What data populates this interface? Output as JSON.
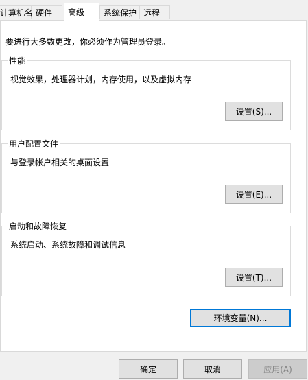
{
  "tabs": [
    {
      "label": "计算机名",
      "active": false
    },
    {
      "label": "硬件",
      "active": false
    },
    {
      "label": "高级",
      "active": true
    },
    {
      "label": "系统保护",
      "active": false
    },
    {
      "label": "远程",
      "active": false
    }
  ],
  "intro": "要进行大多数更改，你必须作为管理员登录。",
  "performance": {
    "title": "性能",
    "description": "视觉效果，处理器计划，内存使用，以及虚拟内存",
    "button": "设置(S)..."
  },
  "user_profiles": {
    "title": "用户配置文件",
    "description": "与登录帐户相关的桌面设置",
    "button": "设置(E)..."
  },
  "startup_recovery": {
    "title": "启动和故障恢复",
    "description": "系统启动、系统故障和调试信息",
    "button": "设置(T)..."
  },
  "env_vars_button": "环境变量(N)...",
  "footer": {
    "ok": "确定",
    "cancel": "取消",
    "apply": "应用(A)"
  }
}
